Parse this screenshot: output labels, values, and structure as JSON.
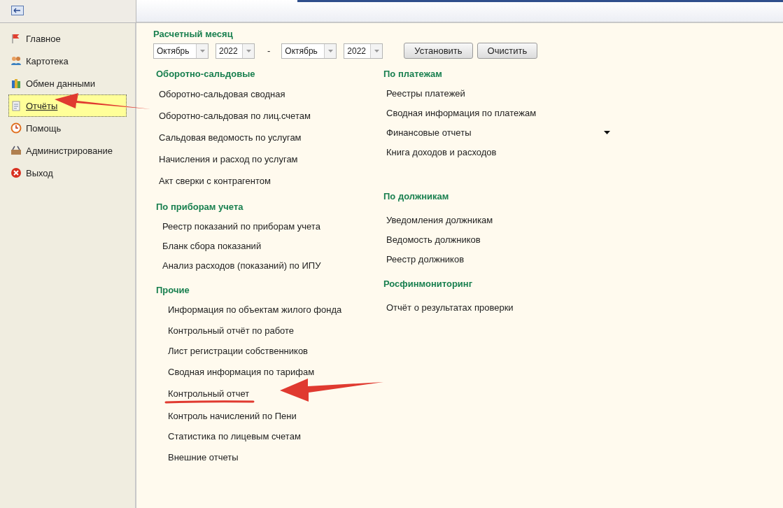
{
  "sidebar": {
    "items": [
      {
        "label": "Главное",
        "selected": false
      },
      {
        "label": "Картотека",
        "selected": false
      },
      {
        "label": "Обмен данными",
        "selected": false
      },
      {
        "label": "Отчёты",
        "selected": true
      },
      {
        "label": "Помощь",
        "selected": false
      },
      {
        "label": "Администрирование",
        "selected": false
      },
      {
        "label": "Выход",
        "selected": false
      }
    ]
  },
  "period": {
    "title": "Расчетный месяц",
    "from_month": "Октябрь",
    "from_year": "2022",
    "separator": "-",
    "to_month": "Октябрь",
    "to_year": "2022",
    "buttons": [
      "Установить",
      "Очистить"
    ]
  },
  "columns": [
    [
      {
        "title": "Оборотно-сальдовые",
        "items": [
          {
            "label": "Оборотно-сальдовая сводная",
            "kind": "link"
          },
          {
            "label": "Оборотно-сальдовая по лиц.счетам",
            "kind": "link"
          },
          {
            "label": "Сальдовая ведомость по услугам",
            "kind": "link"
          },
          {
            "label": "Начисления и расход по услугам",
            "kind": "link"
          },
          {
            "label": "Акт сверки с контрагентом",
            "kind": "link"
          }
        ]
      },
      {
        "title": "По приборам учета",
        "items": [
          {
            "label": "Реестр показаний по приборам учета",
            "kind": "link"
          },
          {
            "label": "Бланк сбора показаний",
            "kind": "link"
          },
          {
            "label": "Анализ расходов (показаний) по ИПУ",
            "kind": "link"
          }
        ]
      },
      {
        "title": "Прочие",
        "items": [
          {
            "label": "Информация по объектам жилого фонда",
            "kind": "link"
          },
          {
            "label": "Контрольный отчёт по работе",
            "kind": "link"
          },
          {
            "label": "Лист регистрации собственников",
            "kind": "link"
          },
          {
            "label": "Сводная информация по тарифам",
            "kind": "link"
          },
          {
            "label": "Контрольный отчет",
            "kind": "link"
          },
          {
            "label": "Контроль начислений по Пени",
            "kind": "link"
          },
          {
            "label": "Статистика по лицевым счетам",
            "kind": "link"
          },
          {
            "label": "Внешние отчеты",
            "kind": "link"
          }
        ]
      }
    ],
    [
      {
        "title": "По платежам",
        "items": [
          {
            "label": "Реестры платежей",
            "kind": "link"
          },
          {
            "label": "Сводная информация по платежам",
            "kind": "link"
          },
          {
            "label": "Финансовые отчеты",
            "kind": "dropdown"
          },
          {
            "label": "Книга доходов и расходов",
            "kind": "link"
          }
        ]
      },
      {
        "title": "По должникам",
        "items": [
          {
            "label": "Уведомления должникам",
            "kind": "link"
          },
          {
            "label": "Ведомость должников",
            "kind": "link"
          },
          {
            "label": "Реестр должников",
            "kind": "link"
          }
        ]
      },
      {
        "title": "Росфинмониторинг",
        "items": [
          {
            "label": "Отчёт о результатах проверки",
            "kind": "link"
          }
        ]
      }
    ]
  ]
}
